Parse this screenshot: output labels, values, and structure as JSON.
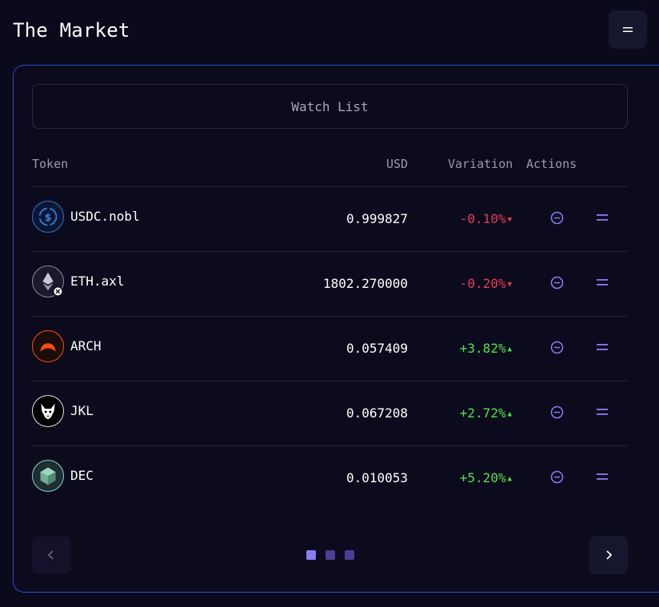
{
  "header": {
    "title": "The Market",
    "menu_icon": "hamburger-icon"
  },
  "card": {
    "watch_list_label": "Watch List",
    "columns": {
      "token": "Token",
      "usd": "USD",
      "variation": "Variation",
      "actions": "Actions"
    },
    "rows": [
      {
        "token": "USDC.nobl",
        "usd": "0.999827",
        "variation": "-0.10%",
        "direction": "down",
        "icon": "usdc-icon"
      },
      {
        "token": "ETH.axl",
        "usd": "1802.270000",
        "variation": "-0.20%",
        "direction": "down",
        "icon": "eth-icon"
      },
      {
        "token": "ARCH",
        "usd": "0.057409",
        "variation": "+3.82%",
        "direction": "up",
        "icon": "arch-icon"
      },
      {
        "token": "JKL",
        "usd": "0.067208",
        "variation": "+2.72%",
        "direction": "up",
        "icon": "jkl-icon"
      },
      {
        "token": "DEC",
        "usd": "0.010053",
        "variation": "+5.20%",
        "direction": "up",
        "icon": "dec-icon"
      }
    ],
    "pagination": {
      "pages": 3,
      "active_page": 1
    }
  },
  "colors": {
    "accent": "#8b7cf6",
    "negative": "#e63a55",
    "positive": "#4ee24a",
    "border": "#2f4bd0"
  }
}
